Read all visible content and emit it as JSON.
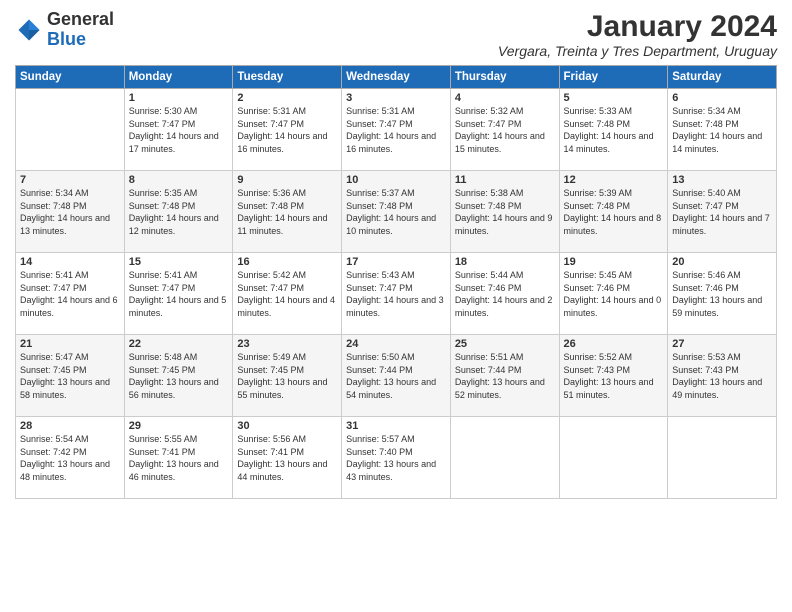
{
  "logo": {
    "general": "General",
    "blue": "Blue"
  },
  "title": "January 2024",
  "subtitle": "Vergara, Treinta y Tres Department, Uruguay",
  "headers": [
    "Sunday",
    "Monday",
    "Tuesday",
    "Wednesday",
    "Thursday",
    "Friday",
    "Saturday"
  ],
  "weeks": [
    [
      {
        "day": "",
        "info": ""
      },
      {
        "day": "1",
        "info": "Sunrise: 5:30 AM\nSunset: 7:47 PM\nDaylight: 14 hours\nand 17 minutes."
      },
      {
        "day": "2",
        "info": "Sunrise: 5:31 AM\nSunset: 7:47 PM\nDaylight: 14 hours\nand 16 minutes."
      },
      {
        "day": "3",
        "info": "Sunrise: 5:31 AM\nSunset: 7:47 PM\nDaylight: 14 hours\nand 16 minutes."
      },
      {
        "day": "4",
        "info": "Sunrise: 5:32 AM\nSunset: 7:47 PM\nDaylight: 14 hours\nand 15 minutes."
      },
      {
        "day": "5",
        "info": "Sunrise: 5:33 AM\nSunset: 7:48 PM\nDaylight: 14 hours\nand 14 minutes."
      },
      {
        "day": "6",
        "info": "Sunrise: 5:34 AM\nSunset: 7:48 PM\nDaylight: 14 hours\nand 14 minutes."
      }
    ],
    [
      {
        "day": "7",
        "info": "Sunrise: 5:34 AM\nSunset: 7:48 PM\nDaylight: 14 hours\nand 13 minutes."
      },
      {
        "day": "8",
        "info": "Sunrise: 5:35 AM\nSunset: 7:48 PM\nDaylight: 14 hours\nand 12 minutes."
      },
      {
        "day": "9",
        "info": "Sunrise: 5:36 AM\nSunset: 7:48 PM\nDaylight: 14 hours\nand 11 minutes."
      },
      {
        "day": "10",
        "info": "Sunrise: 5:37 AM\nSunset: 7:48 PM\nDaylight: 14 hours\nand 10 minutes."
      },
      {
        "day": "11",
        "info": "Sunrise: 5:38 AM\nSunset: 7:48 PM\nDaylight: 14 hours\nand 9 minutes."
      },
      {
        "day": "12",
        "info": "Sunrise: 5:39 AM\nSunset: 7:48 PM\nDaylight: 14 hours\nand 8 minutes."
      },
      {
        "day": "13",
        "info": "Sunrise: 5:40 AM\nSunset: 7:47 PM\nDaylight: 14 hours\nand 7 minutes."
      }
    ],
    [
      {
        "day": "14",
        "info": "Sunrise: 5:41 AM\nSunset: 7:47 PM\nDaylight: 14 hours\nand 6 minutes."
      },
      {
        "day": "15",
        "info": "Sunrise: 5:41 AM\nSunset: 7:47 PM\nDaylight: 14 hours\nand 5 minutes."
      },
      {
        "day": "16",
        "info": "Sunrise: 5:42 AM\nSunset: 7:47 PM\nDaylight: 14 hours\nand 4 minutes."
      },
      {
        "day": "17",
        "info": "Sunrise: 5:43 AM\nSunset: 7:47 PM\nDaylight: 14 hours\nand 3 minutes."
      },
      {
        "day": "18",
        "info": "Sunrise: 5:44 AM\nSunset: 7:46 PM\nDaylight: 14 hours\nand 2 minutes."
      },
      {
        "day": "19",
        "info": "Sunrise: 5:45 AM\nSunset: 7:46 PM\nDaylight: 14 hours\nand 0 minutes."
      },
      {
        "day": "20",
        "info": "Sunrise: 5:46 AM\nSunset: 7:46 PM\nDaylight: 13 hours\nand 59 minutes."
      }
    ],
    [
      {
        "day": "21",
        "info": "Sunrise: 5:47 AM\nSunset: 7:45 PM\nDaylight: 13 hours\nand 58 minutes."
      },
      {
        "day": "22",
        "info": "Sunrise: 5:48 AM\nSunset: 7:45 PM\nDaylight: 13 hours\nand 56 minutes."
      },
      {
        "day": "23",
        "info": "Sunrise: 5:49 AM\nSunset: 7:45 PM\nDaylight: 13 hours\nand 55 minutes."
      },
      {
        "day": "24",
        "info": "Sunrise: 5:50 AM\nSunset: 7:44 PM\nDaylight: 13 hours\nand 54 minutes."
      },
      {
        "day": "25",
        "info": "Sunrise: 5:51 AM\nSunset: 7:44 PM\nDaylight: 13 hours\nand 52 minutes."
      },
      {
        "day": "26",
        "info": "Sunrise: 5:52 AM\nSunset: 7:43 PM\nDaylight: 13 hours\nand 51 minutes."
      },
      {
        "day": "27",
        "info": "Sunrise: 5:53 AM\nSunset: 7:43 PM\nDaylight: 13 hours\nand 49 minutes."
      }
    ],
    [
      {
        "day": "28",
        "info": "Sunrise: 5:54 AM\nSunset: 7:42 PM\nDaylight: 13 hours\nand 48 minutes."
      },
      {
        "day": "29",
        "info": "Sunrise: 5:55 AM\nSunset: 7:41 PM\nDaylight: 13 hours\nand 46 minutes."
      },
      {
        "day": "30",
        "info": "Sunrise: 5:56 AM\nSunset: 7:41 PM\nDaylight: 13 hours\nand 44 minutes."
      },
      {
        "day": "31",
        "info": "Sunrise: 5:57 AM\nSunset: 7:40 PM\nDaylight: 13 hours\nand 43 minutes."
      },
      {
        "day": "",
        "info": ""
      },
      {
        "day": "",
        "info": ""
      },
      {
        "day": "",
        "info": ""
      }
    ]
  ]
}
